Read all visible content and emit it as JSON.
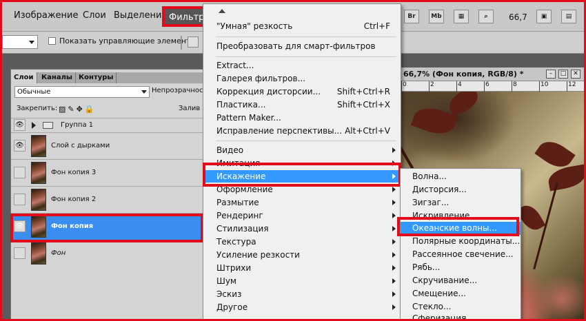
{
  "menubar": {
    "items": [
      "Изображение",
      "Слои",
      "Выделение",
      "Фильтр"
    ],
    "active": "Фильтр",
    "bridge_label": "Br",
    "mini_bridge_label": "Mb",
    "zoom": "66,7"
  },
  "options": {
    "show_controls_label": "Показать управляющие элементы"
  },
  "layers_panel": {
    "tabs": [
      "Слои",
      "Каналы",
      "Контуры"
    ],
    "blend_mode": "Обычные",
    "opacity_label": "Непрозрачность",
    "lock_label": "Закрепить:",
    "fill_label": "Залив",
    "layers": [
      {
        "name": "Группа 1",
        "type": "group",
        "visible": true
      },
      {
        "name": "Слой с дырками",
        "visible": true
      },
      {
        "name": "Фон копия 3",
        "visible": false
      },
      {
        "name": "Фон копия 2",
        "visible": false
      },
      {
        "name": "Фон копия",
        "visible": true,
        "selected": true
      },
      {
        "name": "Фон",
        "visible": false,
        "italic": true
      }
    ]
  },
  "document": {
    "title": "66,7% (Фон копия, RGB/8) *",
    "ruler_labels": [
      "0",
      "2",
      "4",
      "6",
      "8",
      "10",
      "12"
    ]
  },
  "filter_menu": {
    "items": [
      {
        "label": "\"Умная\" резкость",
        "shortcut": "Ctrl+F"
      },
      {
        "label": "Преобразовать для смарт-фильтров"
      },
      {
        "label": "Extract..."
      },
      {
        "label": "Галерея фильтров..."
      },
      {
        "label": "Коррекция дисторсии...",
        "shortcut": "Shift+Ctrl+R"
      },
      {
        "label": "Пластика...",
        "shortcut": "Shift+Ctrl+X"
      },
      {
        "label": "Pattern Maker..."
      },
      {
        "label": "Исправление перспективы...",
        "shortcut": "Alt+Ctrl+V"
      },
      {
        "label": "Видео",
        "submenu": true
      },
      {
        "label": "Имитация",
        "submenu": true
      },
      {
        "label": "Искажение",
        "submenu": true,
        "highlighted": true
      },
      {
        "label": "Оформление",
        "submenu": true
      },
      {
        "label": "Размытие",
        "submenu": true
      },
      {
        "label": "Рендеринг",
        "submenu": true
      },
      {
        "label": "Стилизация",
        "submenu": true
      },
      {
        "label": "Текстура",
        "submenu": true
      },
      {
        "label": "Усиление резкости",
        "submenu": true
      },
      {
        "label": "Штрихи",
        "submenu": true
      },
      {
        "label": "Шум",
        "submenu": true
      },
      {
        "label": "Эскиз",
        "submenu": true
      },
      {
        "label": "Другое",
        "submenu": true
      }
    ]
  },
  "distort_submenu": {
    "items": [
      {
        "label": "Волна..."
      },
      {
        "label": "Дисторсия..."
      },
      {
        "label": "Зигзаг..."
      },
      {
        "label": "Искривление..."
      },
      {
        "label": "Океанские волны...",
        "highlighted": true
      },
      {
        "label": "Полярные координаты..."
      },
      {
        "label": "Рассеянное свечение..."
      },
      {
        "label": "Рябь..."
      },
      {
        "label": "Скручивание..."
      },
      {
        "label": "Смещение..."
      },
      {
        "label": "Стекло..."
      },
      {
        "label": "Сферизация..."
      }
    ]
  }
}
